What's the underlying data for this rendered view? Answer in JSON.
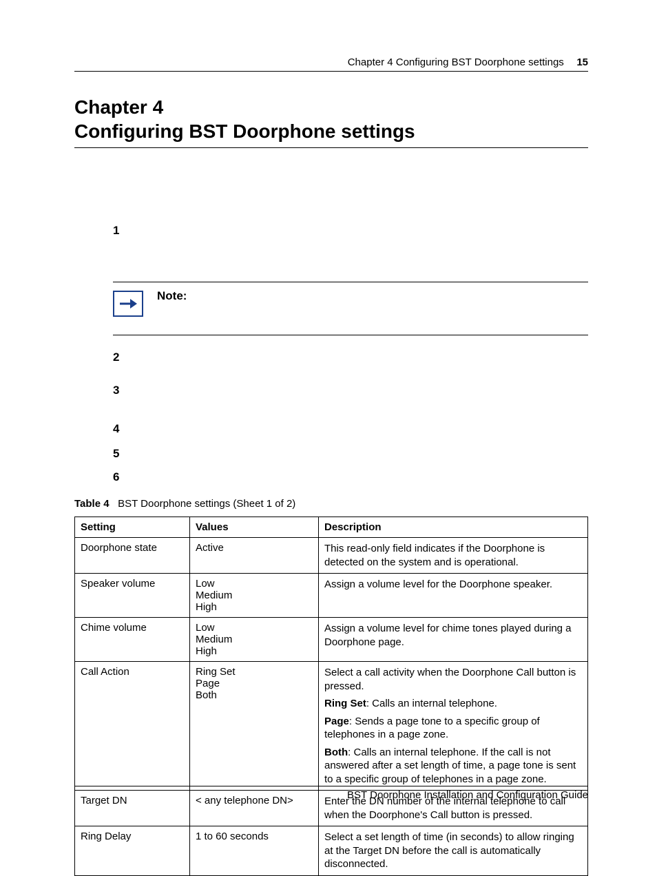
{
  "header": {
    "running": "Chapter 4  Configuring BST Doorphone settings",
    "page_number": "15"
  },
  "chapter": {
    "label": "Chapter 4",
    "title": "Configuring BST Doorphone settings"
  },
  "steps": {
    "s1": "1",
    "s2": "2",
    "s3": "3",
    "s4": "4",
    "s5": "5",
    "s6": "6"
  },
  "note": {
    "label": "Note:"
  },
  "table": {
    "caption_label": "Table 4",
    "caption_text": "BST Doorphone settings (Sheet 1 of 2)",
    "head": {
      "c1": "Setting",
      "c2": "Values",
      "c3": "Description"
    },
    "rows": {
      "r1": {
        "setting": "Doorphone state",
        "values": "Active",
        "desc": "This read-only field indicates if the Doorphone is detected on the system and is operational."
      },
      "r2": {
        "setting": "Speaker volume",
        "values": "Low\nMedium\nHigh",
        "desc": "Assign a volume level for the Doorphone speaker."
      },
      "r3": {
        "setting": "Chime volume",
        "values": "Low\nMedium\nHigh",
        "desc": "Assign a volume level for chime tones played during a Doorphone page."
      },
      "r4": {
        "setting": "Call Action",
        "values": "Ring Set\nPage\nBoth",
        "desc_intro": "Select a call activity when the Doorphone Call button is pressed.",
        "desc_ringset_label": "Ring Set",
        "desc_ringset_text": ": Calls an internal telephone.",
        "desc_page_label": "Page",
        "desc_page_text": ": Sends a page tone to a specific group of telephones in a page zone.",
        "desc_both_label": "Both",
        "desc_both_text": ": Calls an internal telephone. If the call is not answered after a set length of time, a page tone is sent to a specific group of telephones in a page zone."
      },
      "r5": {
        "setting": "Target DN",
        "values": "< any telephone DN>",
        "desc": "Enter the DN number of the internal telephone to call when the Doorphone's Call button is pressed."
      },
      "r6": {
        "setting": "Ring Delay",
        "values": "1 to 60 seconds",
        "desc": "Select a set length of time (in seconds) to allow ringing at the Target DN before the call is automatically disconnected."
      }
    }
  },
  "footer": {
    "text": "BST Doorphone Installation and Configuration Guide"
  }
}
